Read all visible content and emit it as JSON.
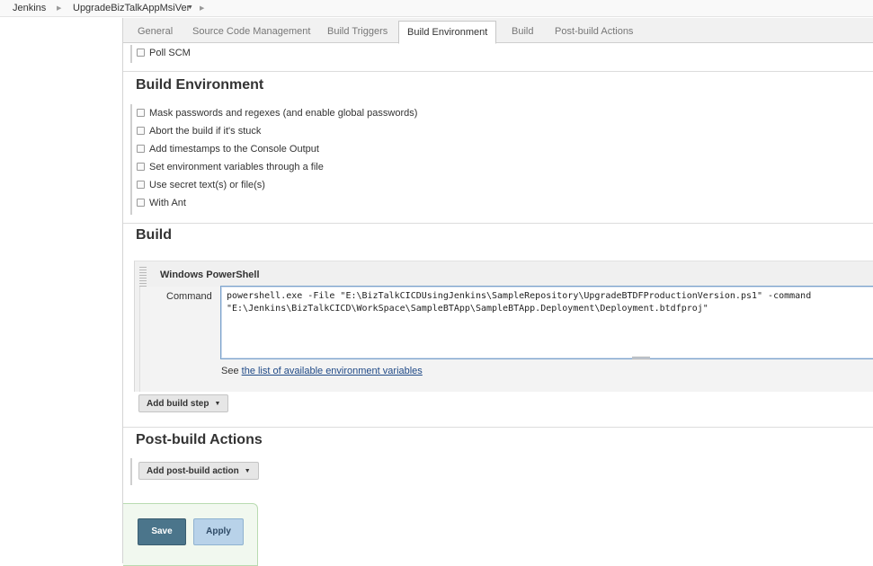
{
  "breadcrumb": {
    "items": [
      "Jenkins",
      "UpgradeBizTalkAppMsiVer"
    ]
  },
  "tabs": [
    "General",
    "Source Code Management",
    "Build Triggers",
    "Build Environment",
    "Build",
    "Post-build Actions"
  ],
  "active_tab": "Build Environment",
  "build_triggers": {
    "poll_scm_label": "Poll SCM"
  },
  "build_environment": {
    "title": "Build Environment",
    "options": [
      "Mask passwords and regexes (and enable global passwords)",
      "Abort the build if it's stuck",
      "Add timestamps to the Console Output",
      "Set environment variables through a file",
      "Use secret text(s) or file(s)",
      "With Ant"
    ]
  },
  "build": {
    "title": "Build",
    "step_title": "Windows PowerShell",
    "command_label": "Command",
    "command_value": "powershell.exe -File \"E:\\BizTalkCICDUsingJenkins\\SampleRepository\\UpgradeBTDFProductionVersion.ps1\" -command\n\"E:\\Jenkins\\BizTalkCICD\\WorkSpace\\SampleBTApp\\SampleBTApp.Deployment\\Deployment.btdfproj\"",
    "see_prefix": "See ",
    "see_link": "the list of available environment variables",
    "add_step_label": "Add build step"
  },
  "post_build": {
    "title": "Post-build Actions",
    "add_action_label": "Add post-build action"
  },
  "buttons": {
    "save": "Save",
    "apply": "Apply"
  },
  "colors": {
    "save_bg": "#4b758b",
    "apply_bg": "#b8d2e9",
    "link": "#204a87"
  }
}
